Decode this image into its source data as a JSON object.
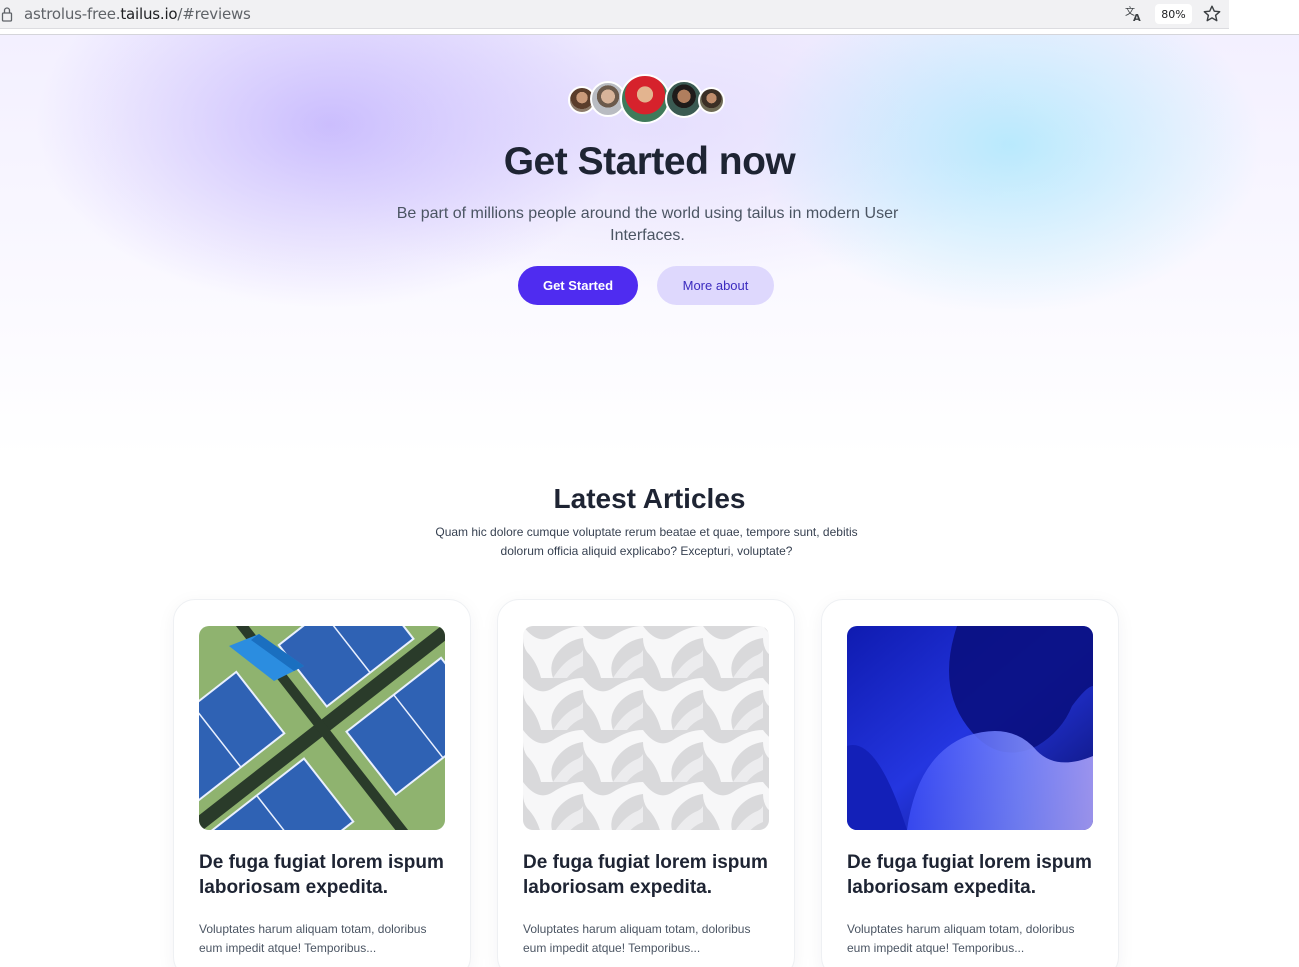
{
  "browser": {
    "url_prefix": "astrolus-free.",
    "url_host": "tailus.io",
    "url_path": "/#reviews",
    "zoom": "80%",
    "icons": [
      "lock-icon",
      "translate-icon",
      "star-icon"
    ]
  },
  "hero": {
    "title": "Get Started now",
    "subtitle": "Be part of millions people around the world using tailus in modern User Interfaces.",
    "primary_button": "Get Started",
    "secondary_button": "More about",
    "accent_color": "#4f2cf0",
    "secondary_color": "#ded8fd"
  },
  "articles": {
    "title": "Latest Articles",
    "subtitle": "Quam hic dolore cumque voluptate rerum beatae et quae, tempore sunt, debitis dolorum officia aliquid explicabo? Excepturi, voluptate?",
    "cards": [
      {
        "title": "De fuga fugiat lorem ispum laboriosam expedita.",
        "excerpt": "Voluptates harum aliquam totam, doloribus eum impedit atque! Temporibus...",
        "image": "tennis-courts-aerial"
      },
      {
        "title": "De fuga fugiat lorem ispum laboriosam expedita.",
        "excerpt": "Voluptates harum aliquam totam, doloribus eum impedit atque! Temporibus...",
        "image": "white-3d-pattern"
      },
      {
        "title": "De fuga fugiat lorem ispum laboriosam expedita.",
        "excerpt": "Voluptates harum aliquam totam, doloribus eum impedit atque! Temporibus...",
        "image": "blue-abstract-waves"
      }
    ]
  }
}
